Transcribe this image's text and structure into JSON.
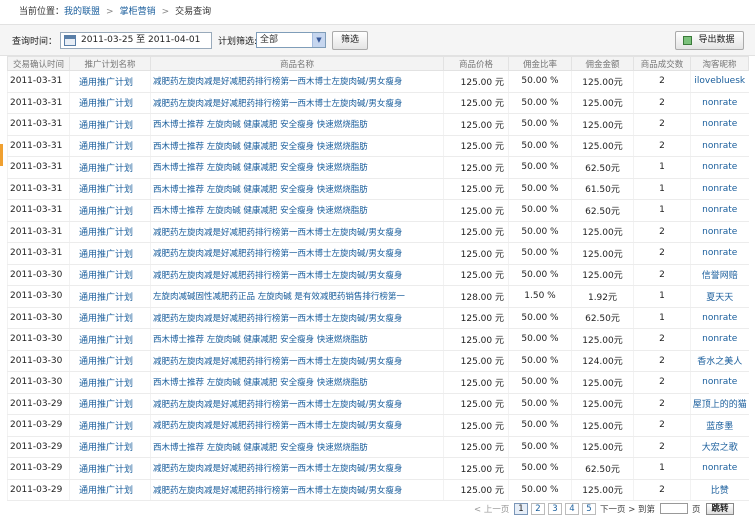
{
  "breadcrumb": {
    "prefix": "当前位置：",
    "items": [
      "我的联盟",
      "掌柜营销",
      "交易查询"
    ],
    "separator": ">"
  },
  "filters": {
    "query_time_label": "查询时间：",
    "date_range": "2011-03-25 至 2011-04-01",
    "plan_filter_label": "计划筛选:",
    "plan_filter_value": "全部",
    "filter_button": "筛选",
    "export_button": "导出数据"
  },
  "table": {
    "headers": [
      "交易确认时间",
      "推广计划名称",
      "商品名称",
      "商品价格",
      "佣金比率",
      "佣金金额",
      "商品成交数",
      "淘客昵称"
    ],
    "rows": [
      [
        "2011-03-31",
        "通用推广计划",
        "减肥药左旋肉减是好减肥药排行榜第一西木博士左旋肉碱/男女瘦身",
        "125.00 元",
        "50.00 %",
        "125.00元",
        "2",
        "ilovebluesk"
      ],
      [
        "2011-03-31",
        "通用推广计划",
        "减肥药左旋肉减是好减肥药排行榜第一西木博士左旋肉碱/男女瘦身",
        "125.00 元",
        "50.00 %",
        "125.00元",
        "2",
        "nonrate"
      ],
      [
        "2011-03-31",
        "通用推广计划",
        "西木博士推荐 左旋肉碱 健康减肥 安全瘦身 快速燃烧脂肪",
        "125.00 元",
        "50.00 %",
        "125.00元",
        "2",
        "nonrate"
      ],
      [
        "2011-03-31",
        "通用推广计划",
        "西木博士推荐 左旋肉碱 健康减肥 安全瘦身 快速燃烧脂肪",
        "125.00 元",
        "50.00 %",
        "125.00元",
        "2",
        "nonrate"
      ],
      [
        "2011-03-31",
        "通用推广计划",
        "西木博士推荐 左旋肉碱 健康减肥 安全瘦身 快速燃烧脂肪",
        "125.00 元",
        "50.00 %",
        "62.50元",
        "1",
        "nonrate"
      ],
      [
        "2011-03-31",
        "通用推广计划",
        "西木博士推荐 左旋肉碱 健康减肥 安全瘦身 快速燃烧脂肪",
        "125.00 元",
        "50.00 %",
        "61.50元",
        "1",
        "nonrate"
      ],
      [
        "2011-03-31",
        "通用推广计划",
        "西木博士推荐 左旋肉碱 健康减肥 安全瘦身 快速燃烧脂肪",
        "125.00 元",
        "50.00 %",
        "62.50元",
        "1",
        "nonrate"
      ],
      [
        "2011-03-31",
        "通用推广计划",
        "减肥药左旋肉减是好减肥药排行榜第一西木博士左旋肉碱/男女瘦身",
        "125.00 元",
        "50.00 %",
        "125.00元",
        "2",
        "nonrate"
      ],
      [
        "2011-03-31",
        "通用推广计划",
        "减肥药左旋肉减是好减肥药排行榜第一西木博士左旋肉碱/男女瘦身",
        "125.00 元",
        "50.00 %",
        "125.00元",
        "2",
        "nonrate"
      ],
      [
        "2011-03-30",
        "通用推广计划",
        "减肥药左旋肉减是好减肥药排行榜第一西木博士左旋肉碱/男女瘦身",
        "125.00 元",
        "50.00 %",
        "125.00元",
        "2",
        "信誉网赔"
      ],
      [
        "2011-03-30",
        "通用推广计划",
        "左旋肉减碱固性减肥药正品 左旋肉碱 是有效减肥药销售排行榜第一",
        "128.00 元",
        "1.50 %",
        "1.92元",
        "1",
        "夏天天"
      ],
      [
        "2011-03-30",
        "通用推广计划",
        "减肥药左旋肉减是好减肥药排行榜第一西木博士左旋肉碱/男女瘦身",
        "125.00 元",
        "50.00 %",
        "62.50元",
        "1",
        "nonrate"
      ],
      [
        "2011-03-30",
        "通用推广计划",
        "西木博士推荐 左旋肉碱 健康减肥 安全瘦身 快速燃烧脂肪",
        "125.00 元",
        "50.00 %",
        "125.00元",
        "2",
        "nonrate"
      ],
      [
        "2011-03-30",
        "通用推广计划",
        "减肥药左旋肉减是好减肥药排行榜第一西木博士左旋肉碱/男女瘦身",
        "125.00 元",
        "50.00 %",
        "124.00元",
        "2",
        "香水之美人"
      ],
      [
        "2011-03-30",
        "通用推广计划",
        "西木博士推荐 左旋肉碱 健康减肥 安全瘦身 快速燃烧脂肪",
        "125.00 元",
        "50.00 %",
        "125.00元",
        "2",
        "nonrate"
      ],
      [
        "2011-03-29",
        "通用推广计划",
        "减肥药左旋肉减是好减肥药排行榜第一西木博士左旋肉碱/男女瘦身",
        "125.00 元",
        "50.00 %",
        "125.00元",
        "2",
        "屋顶上的的猫"
      ],
      [
        "2011-03-29",
        "通用推广计划",
        "减肥药左旋肉减是好减肥药排行榜第一西木博士左旋肉碱/男女瘦身",
        "125.00 元",
        "50.00 %",
        "125.00元",
        "2",
        "蓝彦墨"
      ],
      [
        "2011-03-29",
        "通用推广计划",
        "西木博士推荐 左旋肉碱 健康减肥 安全瘦身 快速燃烧脂肪",
        "125.00 元",
        "50.00 %",
        "125.00元",
        "2",
        "大宏之歌"
      ],
      [
        "2011-03-29",
        "通用推广计划",
        "减肥药左旋肉减是好减肥药排行榜第一西木博士左旋肉碱/男女瘦身",
        "125.00 元",
        "50.00 %",
        "62.50元",
        "1",
        "nonrate"
      ],
      [
        "2011-03-29",
        "通用推广计划",
        "减肥药左旋肉减是好减肥药排行榜第一西木博士左旋肉碱/男女瘦身",
        "125.00 元",
        "50.00 %",
        "125.00元",
        "2",
        "比赞"
      ]
    ]
  },
  "pager": {
    "prev": "< 上一页",
    "pages": [
      "1",
      "2",
      "3",
      "4",
      "5"
    ],
    "current": "1",
    "next": "下一页 >",
    "goto_label": "到第",
    "page_unit": "页",
    "go_button": "跳转"
  },
  "colors": {
    "link": "#1a5e9c",
    "header_bg": "#f3f3f3",
    "filter_bg": "#f5f5f5"
  }
}
